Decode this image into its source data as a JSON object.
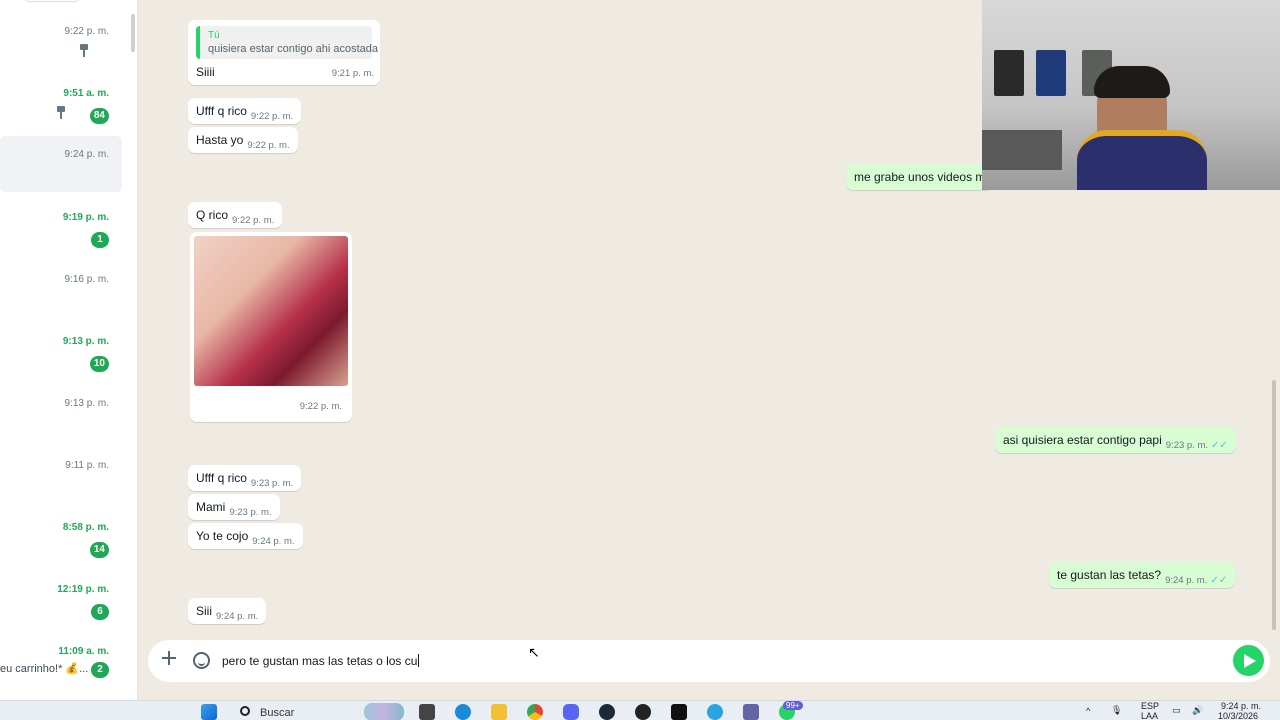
{
  "sidebar": {
    "chats": [
      {
        "time": "9:22 p. m.",
        "unread": false,
        "pinned": true,
        "badge": "",
        "preview": ""
      },
      {
        "time": "9:51 a. m.",
        "unread": true,
        "pinned": true,
        "badge": "84",
        "preview": ""
      },
      {
        "time": "9:24 p. m.",
        "unread": false,
        "pinned": false,
        "badge": "",
        "preview": "",
        "active": true
      },
      {
        "time": "9:19 p. m.",
        "unread": true,
        "pinned": false,
        "badge": "1",
        "preview": ""
      },
      {
        "time": "9:16 p. m.",
        "unread": false,
        "pinned": false,
        "badge": "",
        "preview": ""
      },
      {
        "time": "9:13 p. m.",
        "unread": true,
        "pinned": false,
        "badge": "10",
        "preview": ""
      },
      {
        "time": "9:13 p. m.",
        "unread": false,
        "pinned": false,
        "badge": "",
        "preview": ""
      },
      {
        "time": "9:11 p. m.",
        "unread": false,
        "pinned": false,
        "badge": "",
        "preview": ""
      },
      {
        "time": "8:58 p. m.",
        "unread": true,
        "pinned": false,
        "badge": "14",
        "preview": ""
      },
      {
        "time": "12:19 p. m.",
        "unread": true,
        "pinned": false,
        "badge": "6",
        "preview": ""
      },
      {
        "time": "11:09 a. m.",
        "unread": true,
        "pinned": false,
        "badge": "2",
        "preview": "eu carrinho!* 💰..."
      }
    ]
  },
  "messages": {
    "quoted": {
      "author": "Tú",
      "text": "quisiera estar contigo ahi acostada",
      "reply": "Siiii",
      "time": "9:21 p. m."
    },
    "m1": {
      "text": "Ufff q rico",
      "time": "9:22 p. m."
    },
    "m2": {
      "text": "Hasta yo",
      "time": "9:22 p. m."
    },
    "m3": {
      "text": "Q rico",
      "time": "9:22 p. m."
    },
    "photo_time": "9:22 p. m.",
    "m4": {
      "text": "Ufff q rico",
      "time": "9:23 p. m."
    },
    "m5": {
      "text": "Mami",
      "time": "9:23 p. m."
    },
    "m6": {
      "text": "Yo te cojo",
      "time": "9:24 p. m."
    },
    "m7": {
      "text": "Siii",
      "time": "9:24 p. m."
    },
    "out1": {
      "text": "me grabe unos videos m"
    },
    "out2": {
      "text": "asi quisiera estar contigo papi",
      "time": "9:23 p. m.",
      "ticks": "✓✓"
    },
    "out3": {
      "text": "te gustan las tetas?",
      "time": "9:24 p. m.",
      "ticks": "✓✓"
    }
  },
  "composer": {
    "text": "pero te gustan mas las tetas o los cu"
  },
  "taskbar": {
    "search_label": "Buscar",
    "lang_top": "ESP",
    "lang_bottom": "LAA",
    "clock_time": "9:24 p. m.",
    "clock_date": "10/3/2026",
    "badge": "99+"
  }
}
